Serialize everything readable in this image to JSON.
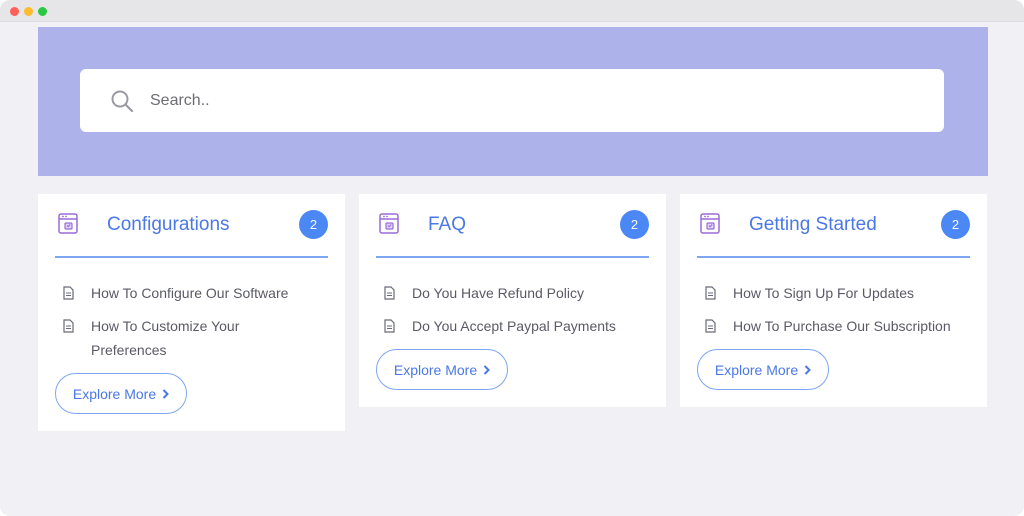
{
  "search": {
    "placeholder": "Search.."
  },
  "categories": [
    {
      "title": "Configurations",
      "count": "2",
      "articles": [
        "How To Configure Our Software",
        "How To Customize Your Preferences"
      ],
      "button": "Explore More"
    },
    {
      "title": "FAQ",
      "count": "2",
      "articles": [
        "Do You Have Refund Policy",
        "Do You Accept Paypal Payments"
      ],
      "button": "Explore More"
    },
    {
      "title": "Getting Started",
      "count": "2",
      "articles": [
        "How To Sign Up For Updates",
        "How To Purchase Our Subscription"
      ],
      "button": "Explore More"
    }
  ],
  "colors": {
    "hero": "#adb2ea",
    "accent": "#4a78e6",
    "badge": "#4b87f5",
    "icon": "#9b6bd8"
  },
  "icons": {
    "search": "search-icon",
    "category": "browser-window-icon",
    "article": "document-icon",
    "chevron": "chevron-right-icon"
  }
}
